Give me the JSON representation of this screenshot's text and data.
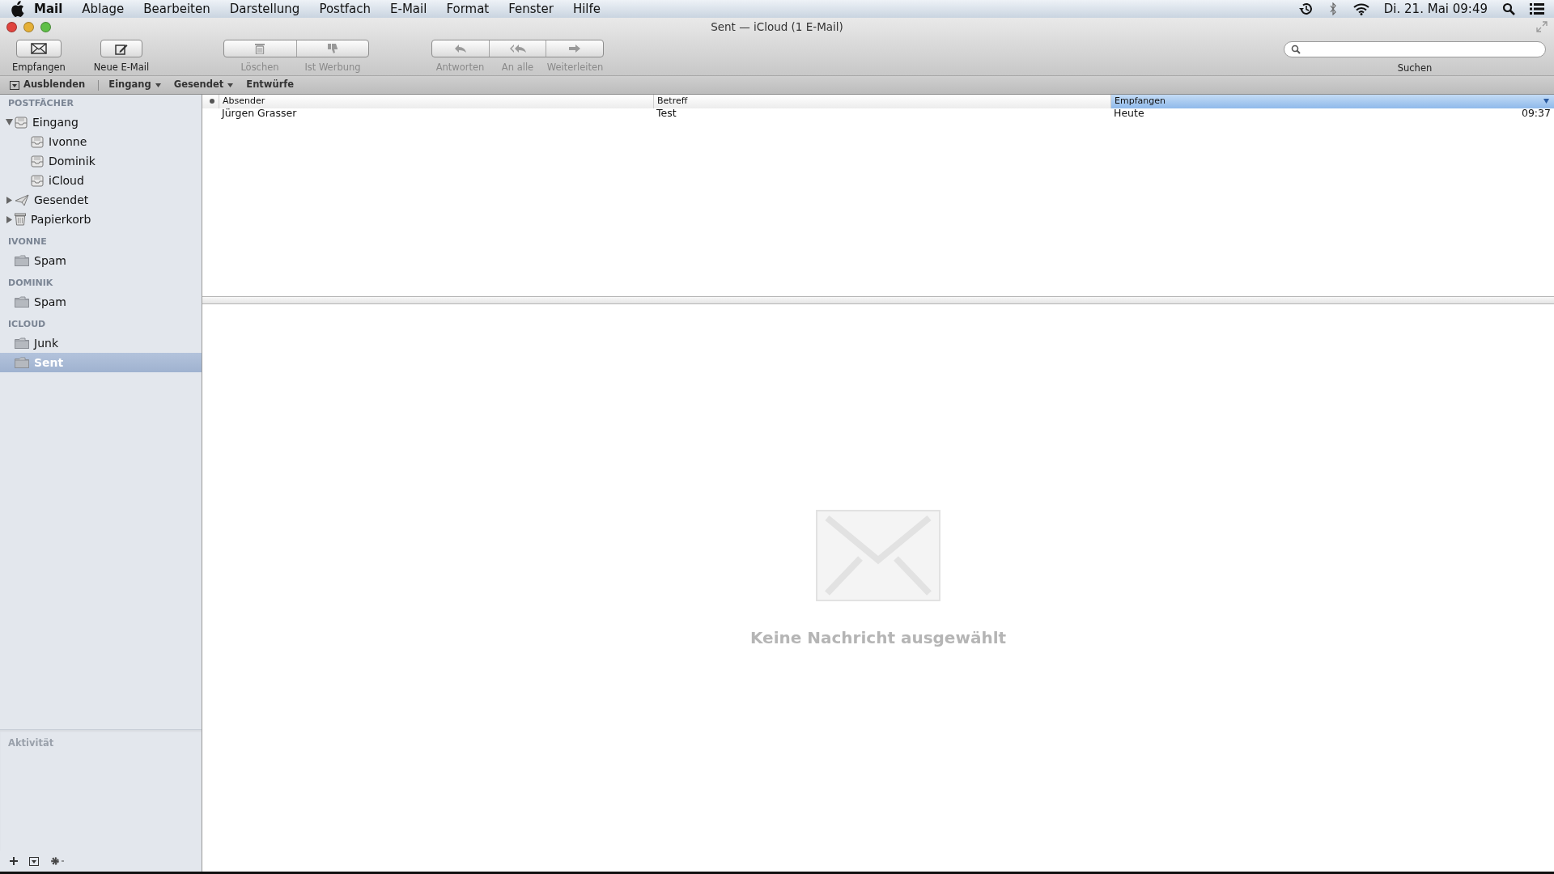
{
  "menu_bar": {
    "app_name": "Mail",
    "items": [
      "Ablage",
      "Bearbeiten",
      "Darstellung",
      "Postfach",
      "E-Mail",
      "Format",
      "Fenster",
      "Hilfe"
    ],
    "clock": "Di. 21. Mai  09:49"
  },
  "window": {
    "title": "Sent — iCloud (1 E-Mail)"
  },
  "toolbar": {
    "groups": [
      {
        "buttons": [
          {
            "label": "Empfangen",
            "kind": "envelope",
            "disabled": false
          }
        ]
      },
      {
        "buttons": [
          {
            "label": "Neue E-Mail",
            "kind": "compose",
            "disabled": false
          }
        ]
      },
      {
        "buttons": [
          {
            "label": "Löschen",
            "kind": "trash",
            "disabled": true
          },
          {
            "label": "Ist Werbung",
            "kind": "thumbdown",
            "disabled": true
          }
        ]
      },
      {
        "buttons": [
          {
            "label": "Antworten",
            "kind": "reply",
            "disabled": true
          },
          {
            "label": "An alle",
            "kind": "replyall",
            "disabled": true
          },
          {
            "label": "Weiterleiten",
            "kind": "forward",
            "disabled": true
          }
        ]
      }
    ],
    "search": {
      "label": "Suchen"
    }
  },
  "favorites_bar": [
    {
      "label": "Ausblenden",
      "kind": "hide"
    },
    {
      "label": "Eingang",
      "kind": "menu"
    },
    {
      "label": "Gesendet",
      "kind": "menu"
    },
    {
      "label": "Entwürfe",
      "kind": "plain"
    }
  ],
  "sidebar": {
    "sections": [
      {
        "heading": "POSTFÄCHER",
        "items": [
          {
            "label": "Eingang",
            "kind": "inbox",
            "expanded": true,
            "selected": false,
            "children": [
              {
                "label": "Ivonne",
                "kind": "inbox",
                "selected": false
              },
              {
                "label": "Dominik",
                "kind": "inbox",
                "selected": false
              },
              {
                "label": "iCloud",
                "kind": "inbox",
                "selected": false
              }
            ]
          },
          {
            "label": "Gesendet",
            "kind": "sent",
            "expanded": false,
            "selected": false
          },
          {
            "label": "Papierkorb",
            "kind": "trash",
            "expanded": false,
            "selected": false
          }
        ]
      },
      {
        "heading": "IVONNE",
        "items": [
          {
            "label": "Spam",
            "kind": "folder",
            "selected": false
          }
        ]
      },
      {
        "heading": "DOMINIK",
        "items": [
          {
            "label": "Spam",
            "kind": "folder",
            "selected": false
          }
        ]
      },
      {
        "heading": "ICLOUD",
        "items": [
          {
            "label": "Junk",
            "kind": "folder",
            "selected": false
          },
          {
            "label": "Sent",
            "kind": "folder",
            "selected": true
          }
        ]
      }
    ],
    "activity": {
      "heading": "Aktivität"
    }
  },
  "message_list": {
    "columns": [
      {
        "label": "Absender",
        "sorted": false
      },
      {
        "label": "Betreff",
        "sorted": false
      },
      {
        "label": "Empfangen",
        "sorted": true
      }
    ],
    "rows": [
      {
        "sender": "Jürgen Grasser",
        "subject": "Test",
        "received_day": "Heute",
        "received_time": "09:37"
      }
    ]
  },
  "preview": {
    "empty_text": "Keine Nachricht ausgewählt"
  }
}
